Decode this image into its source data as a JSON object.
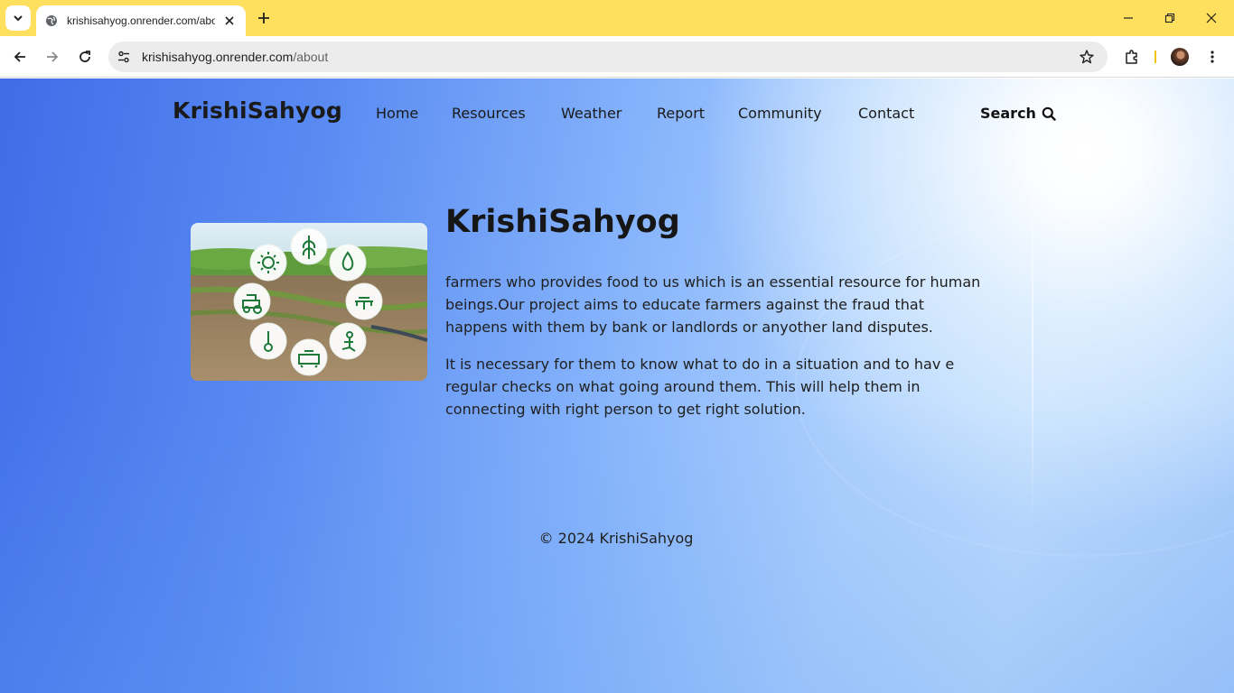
{
  "browser": {
    "tab_title": "krishisahyog.onrender.com/about",
    "url_host": "krishisahyog.onrender.com",
    "url_path": "/about"
  },
  "nav": {
    "logo": "KrishiSahyog",
    "links": [
      "Home",
      "Resources",
      "Weather",
      "Report",
      "Community",
      "Contact"
    ],
    "search_label": "Search"
  },
  "about": {
    "title": "KrishiSahyog",
    "paragraph1": "farmers who provides food to us which is an essential resource for human beings.Our project aims to educate farmers against the fraud that happens with them by bank or landlords or anyother land disputes.",
    "paragraph2": "It is necessary for them to know what to do in a situation and to hav e regular checks on what going around them. This will help them in connecting with right person to get right solution."
  },
  "footer": {
    "text": "© 2024 KrishiSahyog"
  },
  "colors": {
    "tabstrip": "#fedf5e",
    "page_blue": "#3f6de8",
    "page_light": "#bedcfd"
  }
}
